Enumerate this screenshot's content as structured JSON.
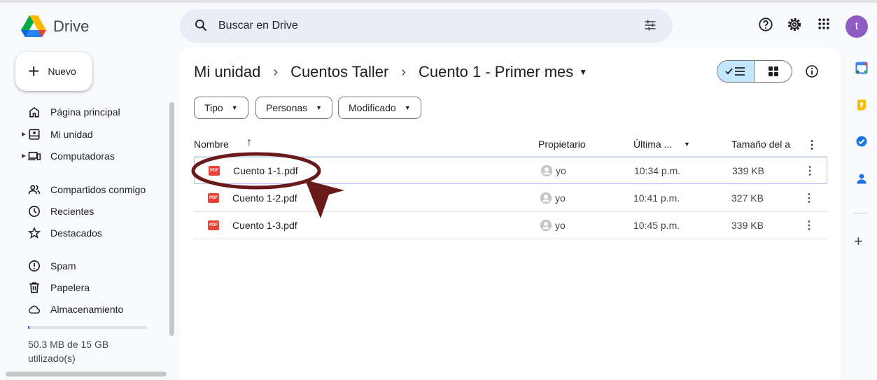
{
  "app": {
    "name": "Drive"
  },
  "search": {
    "placeholder": "Buscar en Drive"
  },
  "user": {
    "avatar_letter": "t",
    "avatar_color": "#8e5cc2"
  },
  "new_button": {
    "label": "Nuevo"
  },
  "sidebar": {
    "items": [
      {
        "label": "Página principal",
        "icon": "home-icon"
      },
      {
        "label": "Mi unidad",
        "icon": "my-drive-icon",
        "expandable": true
      },
      {
        "label": "Computadoras",
        "icon": "computer-icon",
        "expandable": true
      },
      {
        "label": "Compartidos conmigo",
        "icon": "shared-icon"
      },
      {
        "label": "Recientes",
        "icon": "clock-icon"
      },
      {
        "label": "Destacados",
        "icon": "star-icon"
      },
      {
        "label": "Spam",
        "icon": "spam-icon"
      },
      {
        "label": "Papelera",
        "icon": "trash-icon"
      },
      {
        "label": "Almacenamiento",
        "icon": "cloud-icon"
      }
    ],
    "storage": {
      "text": "50.3 MB de 15 GB utilizado(s)",
      "used_fraction": 0.003
    }
  },
  "breadcrumb": {
    "items": [
      "Mi unidad",
      "Cuentos Taller",
      "Cuento 1 - Primer mes"
    ]
  },
  "filters": [
    "Tipo",
    "Personas",
    "Modificado"
  ],
  "table": {
    "columns": {
      "name": "Nombre",
      "owner": "Propietario",
      "modified": "Última ...",
      "size": "Tamaño del a"
    },
    "rows": [
      {
        "name": "Cuento 1-1.pdf",
        "owner": "yo",
        "modified": "10:34 p.m.",
        "size": "339 KB",
        "selected": true
      },
      {
        "name": "Cuento 1-2.pdf",
        "owner": "yo",
        "modified": "10:41 p.m.",
        "size": "327 KB",
        "selected": false
      },
      {
        "name": "Cuento 1-3.pdf",
        "owner": "yo",
        "modified": "10:45 p.m.",
        "size": "339 KB",
        "selected": false
      }
    ],
    "file_badge": "PDF"
  },
  "colors": {
    "accent": "#0b57d0",
    "pdf": "#ea4335",
    "annotation": "#6b1a1a",
    "view_active": "#c2e7ff"
  }
}
